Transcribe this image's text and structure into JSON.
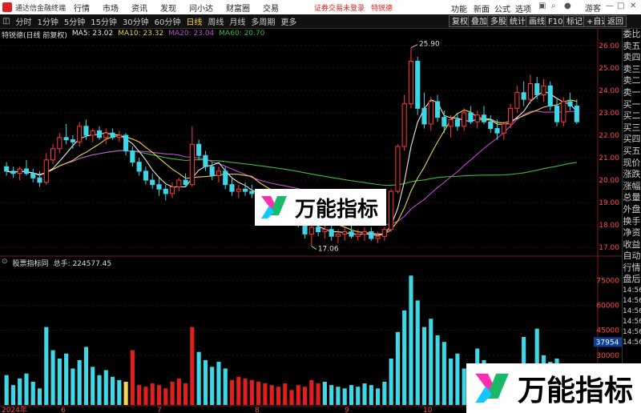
{
  "menubar": {
    "app_title": "通达信金融终端",
    "items": [
      "行情",
      "市场",
      "资讯",
      "发现",
      "问小达",
      "财富圈",
      "交易"
    ],
    "notice": "证券交易未登录",
    "stock_name": "特锐德",
    "right_items": [
      "功能",
      "新面",
      "公式",
      "选项"
    ],
    "user": "游客"
  },
  "toolbar": {
    "periods": [
      "分时",
      "1分钟",
      "5分钟",
      "15分钟",
      "30分钟",
      "60分钟",
      "日线",
      "周线",
      "月线",
      "多周期",
      "更多"
    ],
    "active_period": "日线",
    "right_buttons": [
      "复权",
      "叠加",
      "多股",
      "统计",
      "画线",
      "F10",
      "标记",
      "+自选",
      "返回"
    ]
  },
  "main_legend": {
    "title": "特锐德(日线 前复权)",
    "ma": [
      {
        "label": "MA5: 23.02",
        "color": "#e8e8e8"
      },
      {
        "label": "MA10: 23.32",
        "color": "#e6d24a"
      },
      {
        "label": "MA20: 23.04",
        "color": "#c04ad0"
      },
      {
        "label": "MA60: 20.70",
        "color": "#39b93c"
      }
    ]
  },
  "sub_legend": {
    "title": "股票指标同",
    "total": "总手: 224577.45"
  },
  "side_panel": [
    "委比",
    "卖五",
    "卖四",
    "卖三",
    "卖二",
    "卖一",
    "买一",
    "买二",
    "买三",
    "买四",
    "买五",
    "现价",
    "涨跌",
    "涨幅",
    "总量",
    "外盘",
    "换手",
    "净资",
    "收益",
    "自动",
    "行情",
    "盘后",
    "14:56",
    "14:56",
    "14:56",
    "14:56",
    "14:56",
    "14:56"
  ],
  "watermark": "万能指标",
  "colors": {
    "up": "#ff3a3a",
    "down": "#3fd6e6",
    "bg": "#000000",
    "grid": "#5a1a1a"
  },
  "chart_data": {
    "type": "candlestick",
    "price_axis": {
      "ticks": [
        17.0,
        18.0,
        19.0,
        20.0,
        21.0,
        22.0,
        23.0,
        24.0,
        25.0,
        26.0
      ],
      "ylim": [
        16.9,
        26.6
      ]
    },
    "volume_axis": {
      "ticks": [
        30000,
        45000,
        60000,
        75000
      ],
      "ylim": [
        0,
        82000
      ]
    },
    "current_volume_label": "37954",
    "price_annotations": [
      "25.90",
      "17.06"
    ],
    "x_labels": [
      "2024年",
      "6",
      "7",
      "8",
      "9",
      "10",
      "11"
    ],
    "candles": [
      [
        20.6,
        20.8,
        20.2,
        20.4
      ],
      [
        20.4,
        20.6,
        20.1,
        20.3
      ],
      [
        20.3,
        20.6,
        20.0,
        20.5
      ],
      [
        20.5,
        20.9,
        20.2,
        20.3
      ],
      [
        20.3,
        20.5,
        19.9,
        20.1
      ],
      [
        20.1,
        20.4,
        19.7,
        19.9
      ],
      [
        19.9,
        21.2,
        19.8,
        20.9
      ],
      [
        20.9,
        21.6,
        20.7,
        21.4
      ],
      [
        21.4,
        22.1,
        21.2,
        21.9
      ],
      [
        21.9,
        22.5,
        21.6,
        21.8
      ],
      [
        21.8,
        22.0,
        21.4,
        21.7
      ],
      [
        21.7,
        22.6,
        21.5,
        22.4
      ],
      [
        22.4,
        22.7,
        21.8,
        22.0
      ],
      [
        22.0,
        22.3,
        21.7,
        22.2
      ],
      [
        22.2,
        22.4,
        21.8,
        21.9
      ],
      [
        21.9,
        22.3,
        21.6,
        22.1
      ],
      [
        22.1,
        22.3,
        21.8,
        21.9
      ],
      [
        21.9,
        22.2,
        21.7,
        22.0
      ],
      [
        22.0,
        22.1,
        21.1,
        21.3
      ],
      [
        21.3,
        21.5,
        20.6,
        20.8
      ],
      [
        20.8,
        21.0,
        20.2,
        20.4
      ],
      [
        20.4,
        20.6,
        19.8,
        20.0
      ],
      [
        20.0,
        20.3,
        19.6,
        19.8
      ],
      [
        19.8,
        20.1,
        19.3,
        19.6
      ],
      [
        19.6,
        19.8,
        19.1,
        19.4
      ],
      [
        19.4,
        19.9,
        19.2,
        19.7
      ],
      [
        19.7,
        20.1,
        19.5,
        20.0
      ],
      [
        20.0,
        20.3,
        19.7,
        19.8
      ],
      [
        19.8,
        22.4,
        19.7,
        21.6
      ],
      [
        21.6,
        21.8,
        20.9,
        21.1
      ],
      [
        21.1,
        21.3,
        20.4,
        20.6
      ],
      [
        20.6,
        20.8,
        20.0,
        20.2
      ],
      [
        20.2,
        20.6,
        19.9,
        20.4
      ],
      [
        20.4,
        20.6,
        19.6,
        19.8
      ],
      [
        19.8,
        20.1,
        19.3,
        19.5
      ],
      [
        19.5,
        19.8,
        19.2,
        19.6
      ],
      [
        19.6,
        19.9,
        19.3,
        19.5
      ],
      [
        19.5,
        19.8,
        19.2,
        19.4
      ],
      [
        19.4,
        19.6,
        18.9,
        19.1
      ],
      [
        19.1,
        19.4,
        18.8,
        19.2
      ],
      [
        19.2,
        19.4,
        18.7,
        18.9
      ],
      [
        18.9,
        19.1,
        18.5,
        18.7
      ],
      [
        18.7,
        19.0,
        18.4,
        18.8
      ],
      [
        18.8,
        18.9,
        18.2,
        18.4
      ],
      [
        18.4,
        18.6,
        17.9,
        18.1
      ],
      [
        18.1,
        18.3,
        17.4,
        17.6
      ],
      [
        17.6,
        18.0,
        17.06,
        17.9
      ],
      [
        17.9,
        18.2,
        17.5,
        17.7
      ],
      [
        17.7,
        18.0,
        17.4,
        17.8
      ],
      [
        17.8,
        18.1,
        17.3,
        17.5
      ],
      [
        17.5,
        17.8,
        17.2,
        17.6
      ],
      [
        17.6,
        17.9,
        17.3,
        17.7
      ],
      [
        17.7,
        18.0,
        17.4,
        17.5
      ],
      [
        17.5,
        17.8,
        17.3,
        17.6
      ],
      [
        17.6,
        17.9,
        17.3,
        17.7
      ],
      [
        17.7,
        17.9,
        17.3,
        17.4
      ],
      [
        17.4,
        17.7,
        17.2,
        17.5
      ],
      [
        17.5,
        17.9,
        17.3,
        17.8
      ],
      [
        17.8,
        19.6,
        17.7,
        19.5
      ],
      [
        19.5,
        21.6,
        19.4,
        21.5
      ],
      [
        21.5,
        23.8,
        21.3,
        23.4
      ],
      [
        23.4,
        25.9,
        23.2,
        25.3
      ],
      [
        25.3,
        25.5,
        22.9,
        23.2
      ],
      [
        23.2,
        23.9,
        22.3,
        22.5
      ],
      [
        22.5,
        23.7,
        22.2,
        23.5
      ],
      [
        23.5,
        23.8,
        22.6,
        22.8
      ],
      [
        22.8,
        23.1,
        22.1,
        22.4
      ],
      [
        22.4,
        22.9,
        21.9,
        22.7
      ],
      [
        22.7,
        23.0,
        22.2,
        22.4
      ],
      [
        22.4,
        23.2,
        22.2,
        23.0
      ],
      [
        23.0,
        23.3,
        22.5,
        22.6
      ],
      [
        22.6,
        23.1,
        22.3,
        22.9
      ],
      [
        22.9,
        23.3,
        22.5,
        22.6
      ],
      [
        22.6,
        22.9,
        22.1,
        22.3
      ],
      [
        22.3,
        22.7,
        21.8,
        22.1
      ],
      [
        22.1,
        22.6,
        21.8,
        22.5
      ],
      [
        22.5,
        23.4,
        22.3,
        23.2
      ],
      [
        23.2,
        24.2,
        23.0,
        23.9
      ],
      [
        23.9,
        24.4,
        23.3,
        23.6
      ],
      [
        23.6,
        24.7,
        23.4,
        24.3
      ],
      [
        24.3,
        24.6,
        23.6,
        23.8
      ],
      [
        23.8,
        24.5,
        23.5,
        24.2
      ],
      [
        24.2,
        24.4,
        23.1,
        23.3
      ],
      [
        23.3,
        23.6,
        22.4,
        22.6
      ],
      [
        22.6,
        23.7,
        22.4,
        23.5
      ],
      [
        23.5,
        23.9,
        23.1,
        23.3
      ],
      [
        23.3,
        23.6,
        22.5,
        22.6
      ]
    ],
    "volumes": [
      18000,
      12000,
      16000,
      19000,
      14000,
      10000,
      47000,
      33000,
      28000,
      31000,
      22000,
      27000,
      35000,
      23000,
      18000,
      21000,
      17000,
      15000,
      14000,
      33000,
      12000,
      11000,
      13000,
      12000,
      10000,
      14000,
      16000,
      13000,
      47000,
      32000,
      27000,
      23000,
      26000,
      22000,
      15000,
      17000,
      16000,
      15000,
      14000,
      13000,
      12000,
      11000,
      13000,
      9000,
      12000,
      11000,
      15000,
      13000,
      14000,
      12000,
      11000,
      10000,
      12000,
      11000,
      13000,
      12000,
      10000,
      14000,
      28000,
      44000,
      57000,
      78000,
      63000,
      47000,
      52000,
      42000,
      38000,
      28000,
      31000,
      22000,
      25000,
      34000,
      27000,
      21000,
      18000,
      17000,
      16000,
      23000,
      41000,
      22000,
      46000,
      30000,
      26000,
      28000,
      20000,
      24000,
      18000
    ],
    "volume_colors": [
      "down",
      "down",
      "down",
      "down",
      "down",
      "down",
      "down",
      "down",
      "down",
      "down",
      "down",
      "down",
      "down",
      "down",
      "down",
      "down",
      "down",
      "down",
      "yellow",
      "up",
      "up",
      "up",
      "up",
      "up",
      "up",
      "up",
      "up",
      "up",
      "up",
      "down",
      "down",
      "down",
      "down",
      "down",
      "up",
      "up",
      "up",
      "up",
      "up",
      "up",
      "up",
      "up",
      "up",
      "up",
      "up",
      "up",
      "up",
      "up",
      "down",
      "down",
      "down",
      "down",
      "down",
      "down",
      "down",
      "down",
      "down",
      "down",
      "down",
      "down",
      "down",
      "down",
      "down",
      "down",
      "down",
      "down",
      "down",
      "down",
      "down",
      "down",
      "down",
      "down",
      "down",
      "down",
      "down",
      "down",
      "down",
      "down",
      "down",
      "down",
      "down",
      "down",
      "down",
      "down",
      "down",
      "down",
      "down"
    ]
  }
}
